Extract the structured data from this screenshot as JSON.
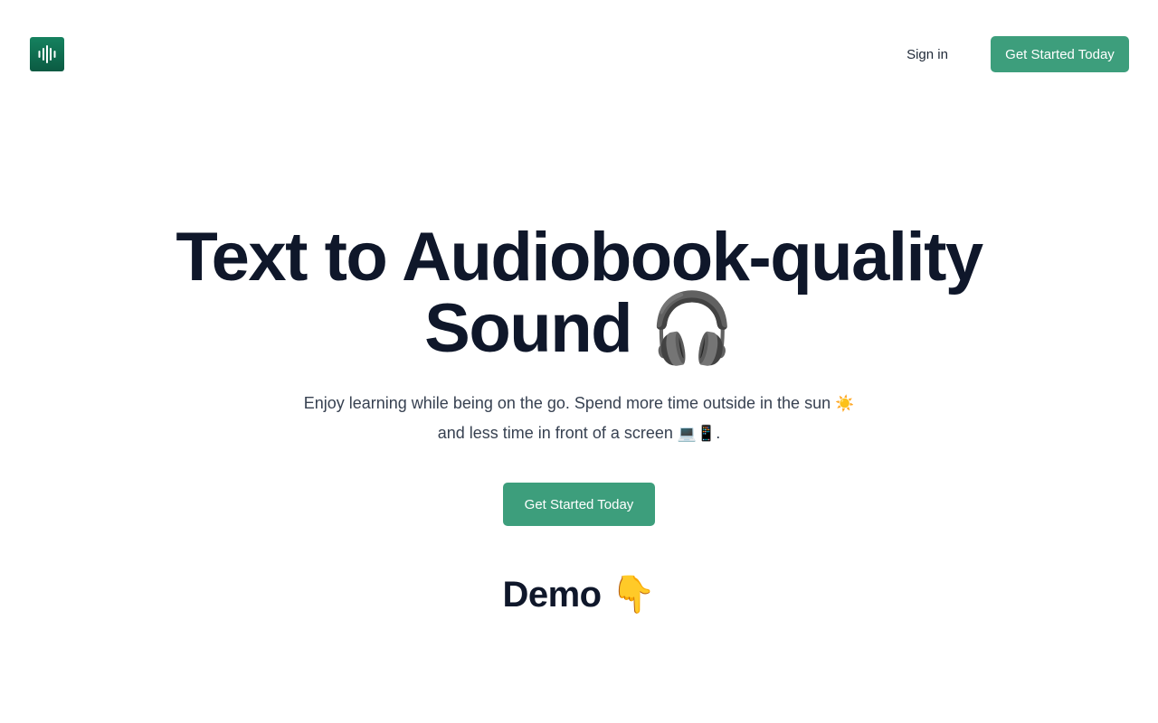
{
  "header": {
    "logo_icon": "soundwave-icon",
    "signin_label": "Sign in",
    "cta_label": "Get Started Today"
  },
  "hero": {
    "title_line1": "Text to Audiobook-quality",
    "title_line2_text": "Sound",
    "title_line2_emoji": "🎧",
    "subtitle_line1_text": "Enjoy learning while being on the go. Spend more time outside in the sun",
    "subtitle_line1_emoji": "☀️",
    "subtitle_line2_text": "and less time in front of a screen",
    "subtitle_line2_emoji": "💻📱",
    "subtitle_line2_end": ".",
    "cta_label": "Get Started Today"
  },
  "demo": {
    "title_text": "Demo",
    "title_emoji": "👇"
  },
  "colors": {
    "brand": "#3d9e7c",
    "logo_dark": "#0b5a42",
    "heading": "#0f172a",
    "body_text": "#374151"
  }
}
